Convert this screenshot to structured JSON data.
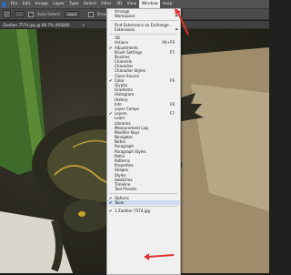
{
  "menubar": {
    "items": [
      "File",
      "Edit",
      "Image",
      "Layer",
      "Type",
      "Select",
      "Filter",
      "3D",
      "View",
      "Window",
      "Help"
    ],
    "active": "Window"
  },
  "options_bar": {
    "auto_select_label": "Auto-Select:",
    "layer_label": "Layer",
    "show_transform_label": "Show Transform"
  },
  "document_tab": {
    "title": "Zoofam 7574.jpg @ 66.7% (RGB/8)",
    "close": "×"
  },
  "window_menu": {
    "items": [
      {
        "type": "item",
        "label": "Arrange",
        "submenu": true
      },
      {
        "type": "item",
        "label": "Workspace",
        "submenu": true
      },
      {
        "type": "sep"
      },
      {
        "type": "item",
        "label": "Find Extensions on Exchange..."
      },
      {
        "type": "item",
        "label": "Extensions",
        "submenu": true
      },
      {
        "type": "sep"
      },
      {
        "type": "item",
        "label": "3D"
      },
      {
        "type": "item",
        "label": "Actions",
        "shortcut": "Alt+F9"
      },
      {
        "type": "item",
        "label": "Adjustments",
        "checked": true
      },
      {
        "type": "item",
        "label": "Brush Settings",
        "shortcut": "F5"
      },
      {
        "type": "item",
        "label": "Brushes"
      },
      {
        "type": "item",
        "label": "Channels"
      },
      {
        "type": "item",
        "label": "Character"
      },
      {
        "type": "item",
        "label": "Character Styles"
      },
      {
        "type": "item",
        "label": "Clone Source"
      },
      {
        "type": "item",
        "label": "Color",
        "shortcut": "F6",
        "checked": true
      },
      {
        "type": "item",
        "label": "Glyphs"
      },
      {
        "type": "item",
        "label": "Gradients"
      },
      {
        "type": "item",
        "label": "Histogram"
      },
      {
        "type": "item",
        "label": "History"
      },
      {
        "type": "item",
        "label": "Info",
        "shortcut": "F8"
      },
      {
        "type": "item",
        "label": "Layer Comps"
      },
      {
        "type": "item",
        "label": "Layers",
        "shortcut": "F7",
        "checked": true
      },
      {
        "type": "item",
        "label": "Learn"
      },
      {
        "type": "item",
        "label": "Libraries"
      },
      {
        "type": "item",
        "label": "Measurement Log"
      },
      {
        "type": "item",
        "label": "Modifier Keys"
      },
      {
        "type": "item",
        "label": "Navigator"
      },
      {
        "type": "item",
        "label": "Notes"
      },
      {
        "type": "item",
        "label": "Paragraph"
      },
      {
        "type": "item",
        "label": "Paragraph Styles"
      },
      {
        "type": "item",
        "label": "Paths"
      },
      {
        "type": "item",
        "label": "Patterns"
      },
      {
        "type": "item",
        "label": "Properties"
      },
      {
        "type": "item",
        "label": "Shapes"
      },
      {
        "type": "item",
        "label": "Styles"
      },
      {
        "type": "item",
        "label": "Swatches"
      },
      {
        "type": "item",
        "label": "Timeline"
      },
      {
        "type": "item",
        "label": "Tool Presets"
      },
      {
        "type": "sep"
      },
      {
        "type": "item",
        "label": "Options",
        "checked": true
      },
      {
        "type": "item",
        "label": "Tools",
        "checked": true,
        "highlighted": true
      },
      {
        "type": "sep"
      },
      {
        "type": "item",
        "label": "1 Zoofam 7574.jpg",
        "checked": true
      }
    ]
  },
  "colors": {
    "menubar_bg": "#535353",
    "menu_bg": "#f0f0f0",
    "arrow_red": "#e0332b"
  }
}
